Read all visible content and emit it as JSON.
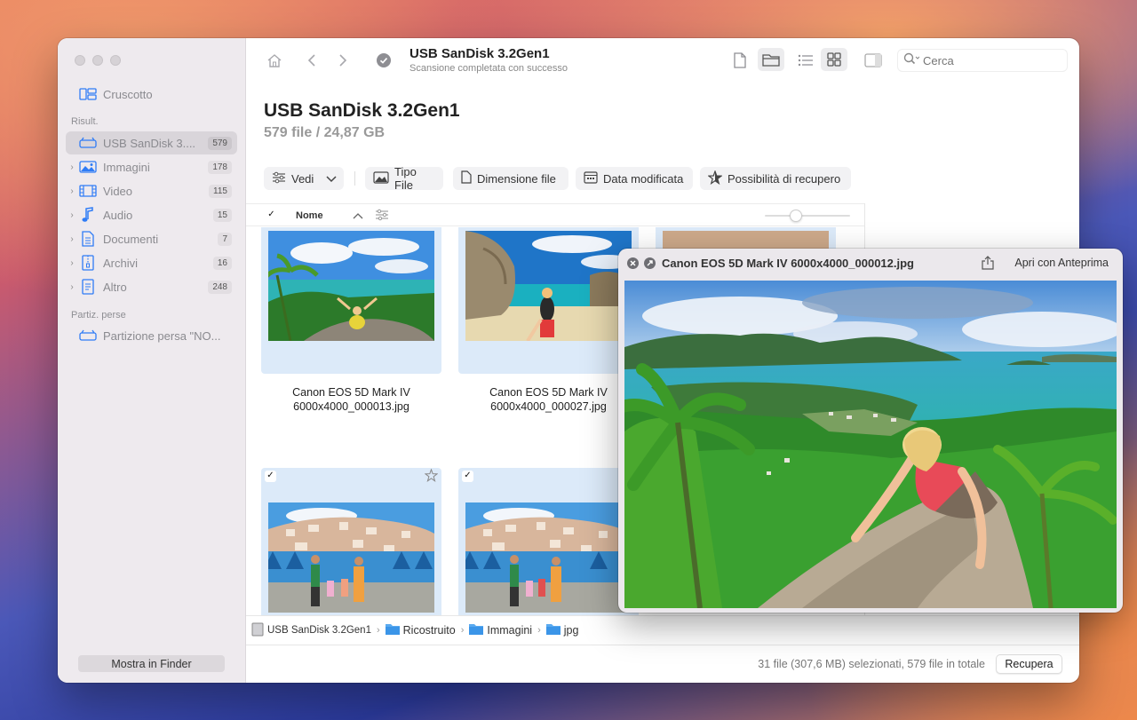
{
  "sidebar": {
    "dashboard_label": "Cruscotto",
    "results_section": "Risult.",
    "items": [
      {
        "label": "USB  SanDisk 3....",
        "count": "579"
      },
      {
        "label": "Immagini",
        "count": "178"
      },
      {
        "label": "Video",
        "count": "115"
      },
      {
        "label": "Audio",
        "count": "15"
      },
      {
        "label": "Documenti",
        "count": "7"
      },
      {
        "label": "Archivi",
        "count": "16"
      },
      {
        "label": "Altro",
        "count": "248"
      }
    ],
    "lost_section": "Partiz. perse",
    "lost_item": "Partizione persa \"NO...",
    "finder_button": "Mostra in Finder"
  },
  "toolbar": {
    "title": "USB  SanDisk 3.2Gen1",
    "subtitle": "Scansione completata con successo",
    "search_placeholder": "Cerca"
  },
  "header": {
    "title": "USB  SanDisk 3.2Gen1",
    "summary": "579 file / 24,87 GB"
  },
  "filters": {
    "view": "Vedi",
    "file_type": "Tipo File",
    "file_size": "Dimensione file",
    "date_modified": "Data modificata",
    "recovery": "Possibilità di recupero"
  },
  "columns": {
    "name": "Nome"
  },
  "files": [
    {
      "caption_line1": "Canon EOS 5D Mark IV",
      "caption_line2": "6000x4000_000013.jpg"
    },
    {
      "caption_line1": "Canon EOS 5D Mark IV",
      "caption_line2": "6000x4000_000027.jpg"
    }
  ],
  "path": {
    "device": "USB  SanDisk 3.2Gen1",
    "folder1": "Ricostruito",
    "folder2": "Immagini",
    "folder3": "jpg"
  },
  "status": {
    "text": "31 file (307,6 MB) selezionati, 579 file in totale",
    "recover_button": "Recupera"
  },
  "quicklook": {
    "title": "Canon EOS 5D Mark IV 6000x4000_000012.jpg",
    "open_with": "Apri con Anteprima"
  },
  "colors": {
    "accent": "#2f7cf6",
    "selection": "#dceaf9",
    "sidebar_bg": "#eeeaee"
  }
}
